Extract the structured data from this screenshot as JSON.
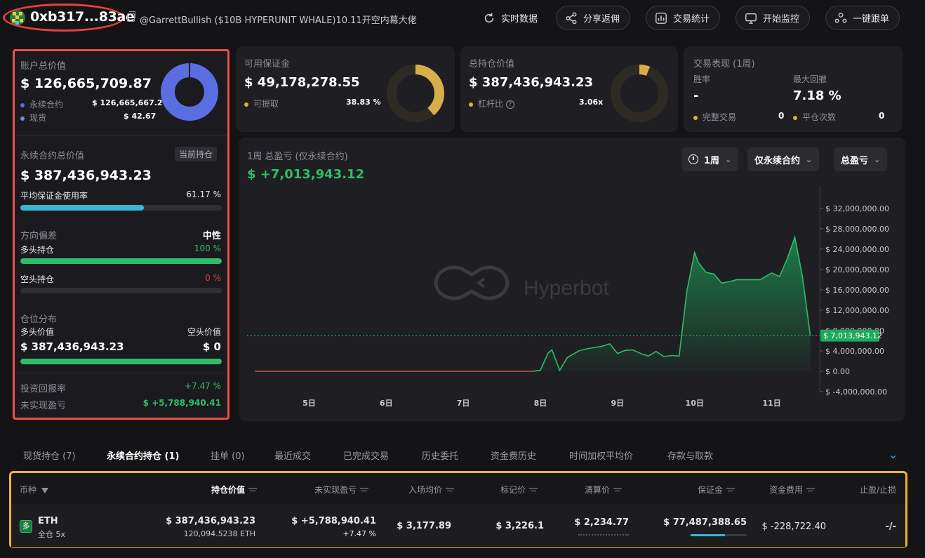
{
  "header": {
    "address": "0xb317...83ae",
    "alias": "@GarrettBullish ($10B HYPERUNIT WHALE)10.11开空内幕大佬",
    "buttons": [
      "实时数据",
      "分享返佣",
      "交易统计",
      "开始监控",
      "一键跟单"
    ]
  },
  "account": {
    "title": "账户总价值",
    "value": "$ 126,665,709.87",
    "legend": [
      {
        "label": "永续合约",
        "value": "$ 126,665,667.2",
        "color": "#5b6ee1"
      },
      {
        "label": "现货",
        "value": "$ 42.67",
        "color": "#5b9be1"
      }
    ],
    "perp_share": 1.0
  },
  "margin": {
    "title": "可用保证金",
    "value": "$ 49,178,278.55",
    "sub_label": "可提取",
    "sub_value": "38.83 %",
    "ratio": 0.3883,
    "color": "#d9ae4a"
  },
  "position_value": {
    "title": "总持仓价值",
    "value": "$ 387,436,943.23",
    "sub_label": "杠杆比",
    "sub_value": "3.06x",
    "ratio": 0.06,
    "color": "#d9ae4a"
  },
  "performance": {
    "title": "交易表现 (1周)",
    "win_rate_label": "胜率",
    "win_rate": "-",
    "drawdown_label": "最大回撤",
    "drawdown": "7.18 %",
    "complete_label": "完整交易",
    "complete_value": "0",
    "close_label": "平仓次数",
    "close_value": "0"
  },
  "perp": {
    "title": "永续合约总价值",
    "badge": "当前持仓",
    "value": "$ 387,436,943.23",
    "margin_usage_label": "平均保证金使用率",
    "margin_usage": "61.17 %",
    "margin_usage_ratio": 0.6117,
    "direction_label": "方向偏差",
    "direction_value": "中性",
    "long_label": "多头持仓",
    "long_pct": "100 %",
    "long_ratio": 1.0,
    "short_label": "空头持仓",
    "short_pct": "0 %",
    "short_ratio": 0.0,
    "dist_label": "仓位分布",
    "long_value_label": "多头价值",
    "short_value_label": "空头价值",
    "long_value": "$ 387,436,943.23",
    "short_value": "$ 0",
    "roi_label": "投资回报率",
    "roi": "+7.47 %",
    "upnl_label": "未实现盈亏",
    "upnl": "$ +5,788,940.41"
  },
  "pnl_chart": {
    "title": "1周 总盈亏 (仅永续合约)",
    "value": "$ +7,013,943.12",
    "controls": [
      "1周",
      "仅永续合约",
      "总盈亏"
    ],
    "watermark": "Hyperbot"
  },
  "chart_data": {
    "type": "area",
    "title": "1周 总盈亏 (仅永续合约)",
    "x_ticks": [
      "5日",
      "6日",
      "7日",
      "8日",
      "9日",
      "10日",
      "11日"
    ],
    "x_tick_positions": [
      5,
      6,
      7,
      8,
      9,
      10,
      11
    ],
    "y_ticks": [
      "$ 32,000,000.00",
      "$ 28,000,000.00",
      "$ 24,000,000.00",
      "$ 20,000,000.00",
      "$ 16,000,000.00",
      "$ 12,000,000.00",
      "$ 8,000,000.00",
      "$ 4,000,000.00",
      "$ 0.00",
      "$ -4,000,000.00"
    ],
    "y_tick_values": [
      32000000,
      28000000,
      24000000,
      20000000,
      16000000,
      12000000,
      8000000,
      4000000,
      0,
      -4000000
    ],
    "ylim": [
      -4000000,
      35000000
    ],
    "xlim": [
      4.25,
      11.55
    ],
    "current_label": "$ 7,013,943.12",
    "current_value": 7013943.12,
    "x": [
      4.3,
      7.9,
      8.0,
      8.1,
      8.15,
      8.25,
      8.35,
      8.5,
      8.6,
      8.8,
      8.9,
      9.0,
      9.1,
      9.2,
      9.3,
      9.4,
      9.5,
      9.6,
      9.7,
      9.8,
      9.9,
      10.0,
      10.05,
      10.15,
      10.25,
      10.35,
      10.45,
      10.55,
      10.7,
      10.85,
      11.0,
      11.1,
      11.2,
      11.3,
      11.4,
      11.5
    ],
    "values": [
      0,
      0,
      200000,
      3600000,
      4200000,
      200000,
      2700000,
      4000000,
      4400000,
      4900000,
      5400000,
      3500000,
      4100000,
      4200000,
      3500000,
      3000000,
      3900000,
      2900000,
      3100000,
      3000000,
      15700000,
      23300000,
      21300000,
      19400000,
      19100000,
      17300000,
      17600000,
      18000000,
      18000000,
      18000000,
      19300000,
      18600000,
      22000000,
      26300000,
      18500000,
      7013943
    ]
  },
  "tabs": [
    "现货持仓 (7)",
    "永续合约持仓 (1)",
    "挂单 (0)",
    "最近成交",
    "已完成交易",
    "历史委托",
    "资金费历史",
    "时间加权平均价",
    "存款与取款"
  ],
  "table": {
    "headers": [
      "币种",
      "持仓价值",
      "未实现盈亏",
      "入场均价",
      "标记价",
      "清算价",
      "保证金",
      "资金费用",
      "止盈/止损"
    ],
    "row": {
      "side_badge": "多",
      "coin": "ETH",
      "mode": "全仓 5x",
      "position_value": "$ 387,436,943.23",
      "position_size": "120,094.5238 ETH",
      "upnl": "$ +5,788,940.41",
      "upnl_pct": "+7.47 %",
      "entry": "$ 3,177.89",
      "mark": "$ 3,226.1",
      "liq": "$ 2,234.77",
      "margin": "$ 77,487,388.65",
      "margin_ratio": 0.61,
      "funding": "$ -228,722.40",
      "tpsl": "-/-"
    }
  }
}
